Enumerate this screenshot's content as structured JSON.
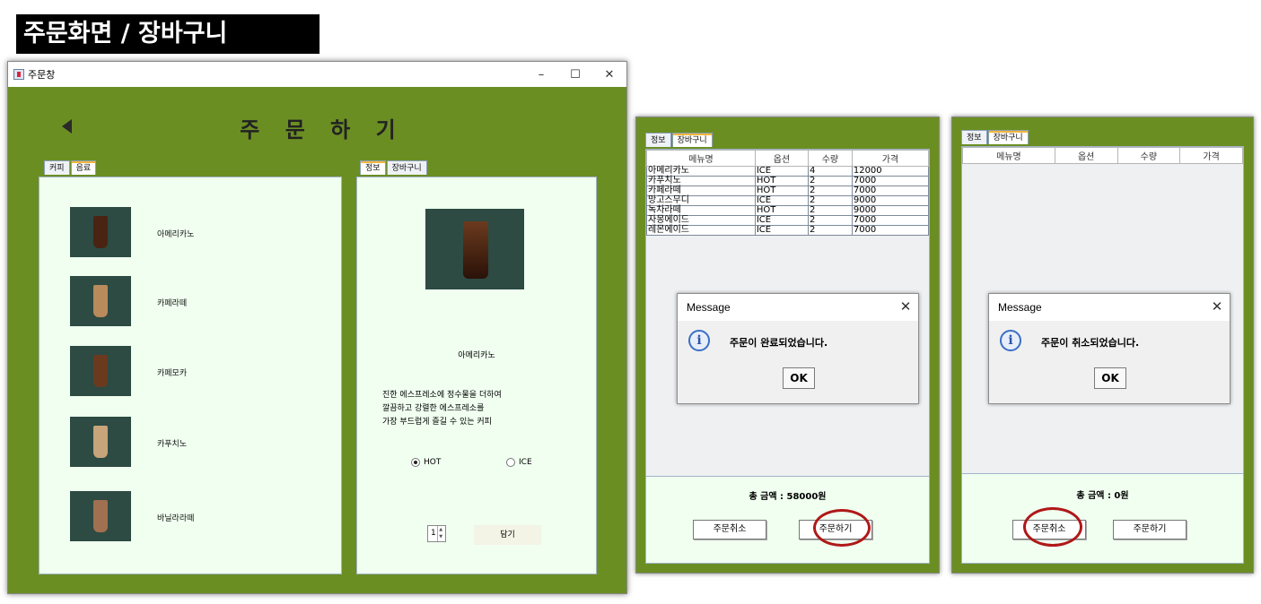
{
  "banner": {
    "title": "주문화면 / 장바구니"
  },
  "window": {
    "title": "주문창",
    "controls": {
      "minimize": "–",
      "maximize": "☐",
      "close": "✕"
    },
    "heading": "주 문 하 기"
  },
  "menu_tabs": [
    "커피",
    "음료"
  ],
  "detail_tabs": [
    "정보",
    "장바구니"
  ],
  "menu_items": [
    {
      "name": "아메리카노",
      "cup_color": "#4a2412"
    },
    {
      "name": "카페라떼",
      "cup_color": "#b88a5c"
    },
    {
      "name": "카페모카",
      "cup_color": "#6b3a1e"
    },
    {
      "name": "카푸치노",
      "cup_color": "#c7a47a"
    },
    {
      "name": "바닐라라떼",
      "cup_color": "#a07050"
    }
  ],
  "detail": {
    "name": "아메리카노",
    "desc": [
      "진한 에스프레소에 정수물을 더하여",
      "깔끔하고 강렬한 에스프레소를",
      "가장 부드럽게 즐길 수 있는 커피"
    ],
    "options": {
      "hot": "HOT",
      "ice": "ICE",
      "selected": "HOT"
    },
    "quantity": "1",
    "close_label": "담기"
  },
  "cart_tabs": [
    "정보",
    "장바구니"
  ],
  "cart_columns": [
    "메뉴명",
    "옵션",
    "수량",
    "가격"
  ],
  "cart1": {
    "rows": [
      [
        "아메리카노",
        "ICE",
        "4",
        "12000"
      ],
      [
        "카푸치노",
        "HOT",
        "2",
        "7000"
      ],
      [
        "카페라떼",
        "HOT",
        "2",
        "7000"
      ],
      [
        "망고스무디",
        "ICE",
        "2",
        "9000"
      ],
      [
        "녹차라떼",
        "HOT",
        "2",
        "9000"
      ],
      [
        "자몽에이드",
        "ICE",
        "2",
        "7000"
      ],
      [
        "레몬에이드",
        "ICE",
        "2",
        "7000"
      ]
    ],
    "total": "총 금액 : 58000원",
    "cancel_label": "주문취소",
    "order_label": "주문하기",
    "dialog": {
      "title": "Message",
      "message": "주문이 완료되었습니다.",
      "ok": "OK",
      "close": "✕",
      "icon": "i"
    }
  },
  "cart2": {
    "total": "총 금액 : 0원",
    "cancel_label": "주문취소",
    "order_label": "주문하기",
    "dialog": {
      "title": "Message",
      "message": "주문이 취소되었습니다.",
      "ok": "OK",
      "close": "✕",
      "icon": "i"
    }
  }
}
